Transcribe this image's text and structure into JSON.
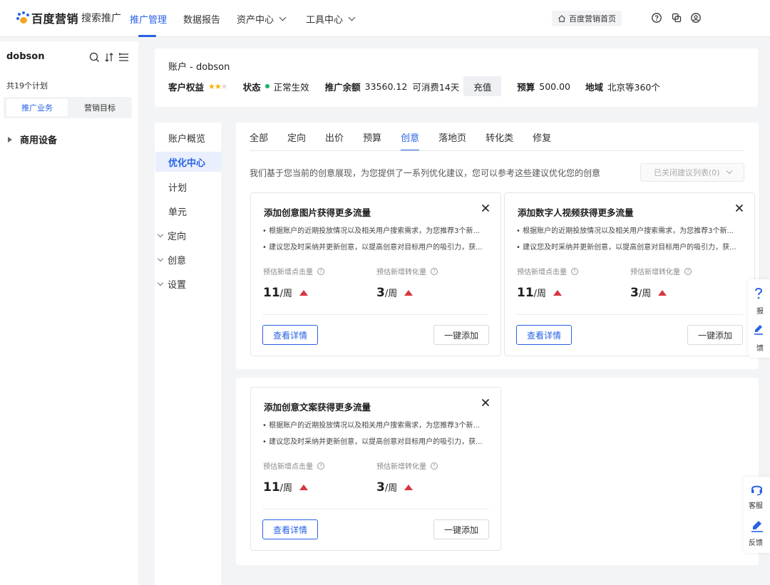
{
  "brand": {
    "name": "百度营销",
    "product": "搜索推广"
  },
  "nav": [
    {
      "label": "推广管理",
      "active": true
    },
    {
      "label": "数据报告"
    },
    {
      "label": "资产中心"
    },
    {
      "label": "工具中心"
    }
  ],
  "header": {
    "home_label": "百度营销首页"
  },
  "left": {
    "account": "dobson",
    "plan_count": "共19个计划",
    "seg_active": "推广业务",
    "seg_other": "营销目标",
    "tree_item": "商用设备"
  },
  "account_card": {
    "title": "账户 - dobson",
    "rights_label": "客户权益",
    "stars": "★★",
    "stars_off": "★",
    "status_label": "状态",
    "status_value": "正常生效",
    "balance_label": "推广余额",
    "balance_value": "33560.12",
    "balance_days": "可消费14天",
    "recharge": "充值",
    "budget_label": "预算",
    "budget_value": "500.00",
    "region_label": "地域",
    "region_value": "北京等360个"
  },
  "subnav": [
    {
      "label": "账户概览"
    },
    {
      "label": "优化中心",
      "active": true
    },
    {
      "label": "计划"
    },
    {
      "label": "单元"
    },
    {
      "label": "定向",
      "expand": true
    },
    {
      "label": "创意",
      "expand": true
    },
    {
      "label": "设置",
      "expand": true
    }
  ],
  "tabs": [
    {
      "label": "全部"
    },
    {
      "label": "定向"
    },
    {
      "label": "出价"
    },
    {
      "label": "预算"
    },
    {
      "label": "创意",
      "active": true
    },
    {
      "label": "落地页"
    },
    {
      "label": "转化类"
    },
    {
      "label": "修复"
    }
  ],
  "description": "我们基于您当前的创意展现，为您提供了一系列优化建议，您可以参考这些建议优化您的创意",
  "closed_list": "已关闭建议列表(0)",
  "cards": [
    {
      "title": "添加创意图片获得更多流量",
      "bullet1": "• 根据账户的近期投放情况以及相关用户搜索需求，为您推荐3个新...",
      "bullet2": "• 建议您及时采纳并更新创意，以提高创意对目标用户的吸引力，获...",
      "metric1_label": "预估新增点击量",
      "metric1_value": "11",
      "metric2_label": "预估新增转化量",
      "metric2_value": "3",
      "unit": "/周",
      "detail_btn": "查看详情",
      "add_btn": "一键添加"
    },
    {
      "title": "添加数字人视频获得更多流量",
      "bullet1": "• 根据账户的近期投放情况以及相关用户搜索需求，为您推荐3个新...",
      "bullet2": "• 建议您及时采纳并更新创意，以提高创意对目标用户的吸引力，获...",
      "metric1_label": "预估新增点击量",
      "metric1_value": "11",
      "metric2_label": "预估新增转化量",
      "metric2_value": "3",
      "unit": "/周",
      "detail_btn": "查看详情",
      "add_btn": "一键添加"
    },
    {
      "title": "添加创意文案获得更多流量",
      "bullet1": "• 根据账户的近期投放情况以及相关用户搜索需求，为您推荐3个新...",
      "bullet2": "• 建议您及时采纳并更新创意，以提高创意对目标用户的吸引力，获...",
      "metric1_label": "预估新增点击量",
      "metric1_value": "11",
      "metric2_label": "预估新增转化量",
      "metric2_value": "3",
      "unit": "/周",
      "detail_btn": "查看详情",
      "add_btn": "一键添加"
    }
  ],
  "float_a": {
    "label1": "报",
    "label2": "馈"
  },
  "float_b": {
    "service": "客服",
    "feedback": "反馈"
  },
  "colors": {
    "accent": "#2862e5",
    "up": "#d9363e",
    "status_ok": "#17b26a",
    "star": "#f5b400"
  }
}
